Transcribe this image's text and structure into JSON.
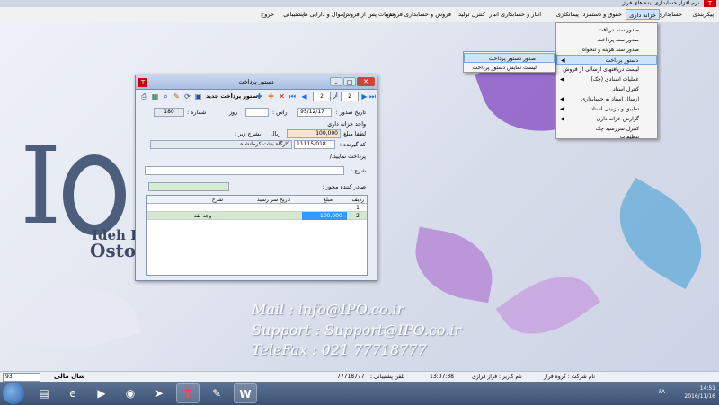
{
  "app": {
    "title": "نرم افزار حسابداری ایده های فراز",
    "logo_letter": "T"
  },
  "menubar": {
    "items": [
      {
        "label": "پیکربندی"
      },
      {
        "label": "حسابداری"
      },
      {
        "label": "خزانه داری"
      },
      {
        "label": "حقوق و دستمزد"
      },
      {
        "label": "پیمانکاری"
      },
      {
        "label": "انبار و حسابداری انبار"
      },
      {
        "label": "کنترل تولید"
      },
      {
        "label": "فروش و حسابداری فروش"
      },
      {
        "label": "خدمات پس از فروش"
      },
      {
        "label": "اموال و دارایی ها"
      },
      {
        "label": "پشتیبانی"
      },
      {
        "label": "خروج"
      }
    ]
  },
  "treasury_menu": {
    "items": [
      {
        "label": "صدور سند دریافت",
        "submenu": false
      },
      {
        "label": "صدور سند پرداخت",
        "submenu": false
      },
      {
        "label": "صدور سند هزینه و تنخواه",
        "submenu": false
      },
      {
        "label": "دستور پرداخت",
        "submenu": true,
        "highlighted": true
      },
      {
        "label": "لیست دریافتهای ارسالی از فروش",
        "submenu": false
      },
      {
        "label": "عملیات اسنادی (چک)",
        "submenu": true
      },
      {
        "label": "کنترل اسناد",
        "submenu": false
      },
      {
        "label": "ارسال اسناد به حسابداری",
        "submenu": true
      },
      {
        "label": "تطبیق و بازبینی اسناد",
        "submenu": true
      },
      {
        "label": "گزارش خزانه داری",
        "submenu": true
      },
      {
        "label": "کنترل سررسید چک",
        "submenu": false
      },
      {
        "label": "تنظیمات",
        "submenu": false
      }
    ]
  },
  "payment_order_submenu": {
    "items": [
      {
        "label": "صدور دستور پرداخت",
        "highlighted": true
      },
      {
        "label": "لیست نمایش دستور پرداخت",
        "highlighted": false
      }
    ]
  },
  "window": {
    "title": "دستور پرداخت",
    "toolbar": {
      "new_label": "دستور پرداخت جدید",
      "record_current": "2",
      "of_label": "از",
      "record_total": "2"
    },
    "fields": {
      "issue_date_label": "تاریخ صدور :",
      "issue_date": "95/12/17",
      "due_label": "راس :",
      "due_value": "",
      "day_label": "روز",
      "number_label": "شماره :",
      "number_value": "180",
      "treasury_unit_label": "واحد خزانه داری",
      "amount_label": "لطفا مبلغ",
      "amount_value": "100,000",
      "currency_label": "ریال",
      "details_label": "بشرح زیر :",
      "recipient_code_label": "کد گیرنده :",
      "recipient_code": "11115-018",
      "recipient_name": "کارگاه بعثت کرمانشاه",
      "pay_label": "پرداخت نمایید./",
      "description_label": "شرح :",
      "description_value": "",
      "permit_issuer_label": "صادر کننده مجوز :",
      "permit_issuer_value": ""
    },
    "grid": {
      "headers": {
        "row": "ردیف",
        "amount": "مبلغ",
        "due_date": "تاریخ سر رسید",
        "desc": "شرح"
      },
      "rows": [
        {
          "row": "1",
          "amount": "",
          "due_date": "",
          "desc": ""
        },
        {
          "row": "2",
          "amount": "100,000",
          "due_date": "",
          "desc": "وجه نقد"
        }
      ]
    }
  },
  "desktop": {
    "logo_i": "I",
    "logo_line1": "Ideh Par",
    "logo_line2": "Ostoo",
    "mail": "Mail : info@IPO.co.ir",
    "support": "Support : Support@IPO.co.ir",
    "telefax": "TeleFax : 021 77718777"
  },
  "statusbar": {
    "year_combo": "93",
    "year_label": "سال مالی",
    "company": "نام شرکت : گروه فراز",
    "user": "نام کاربر : فراز فرازی",
    "time": "13:07:38",
    "support_phone_label": "تلفن پشتیبانی :",
    "support_phone": "77718777"
  },
  "taskbar": {
    "lang": "FA",
    "time": "14:51",
    "date": "2016/11/16"
  },
  "colors": {
    "menu_highlight": "#cde3f9",
    "selected_cell": "#3399ff",
    "amount_field": "#fbe4cc",
    "permit_field": "#d5ecd0"
  }
}
